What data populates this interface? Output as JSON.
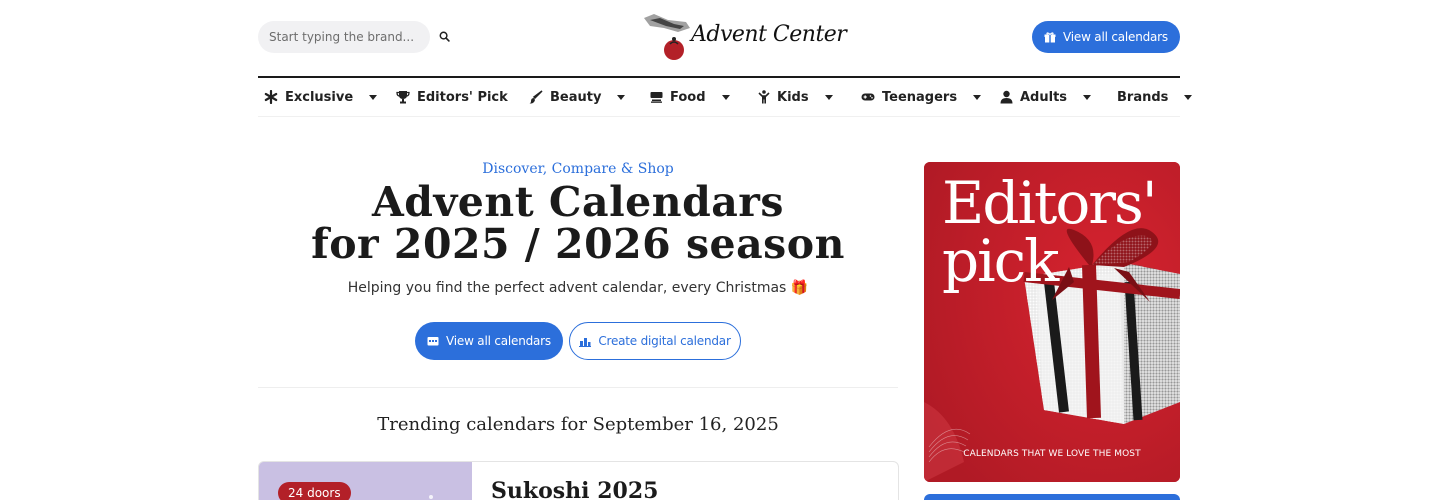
{
  "header": {
    "search_placeholder": "Start typing the brand...",
    "logo_text": "Advent Center",
    "view_all_label": "View all calendars"
  },
  "nav": {
    "items": [
      {
        "label": "Exclusive",
        "icon": "asterisk-icon",
        "dropdown": true
      },
      {
        "label": "Editors' Pick",
        "icon": "trophy-icon",
        "dropdown": false
      },
      {
        "label": "Beauty",
        "icon": "brush-icon",
        "dropdown": true
      },
      {
        "label": "Food",
        "icon": "food-icon",
        "dropdown": true
      },
      {
        "label": "Kids",
        "icon": "child-icon",
        "dropdown": true
      },
      {
        "label": "Teenagers",
        "icon": "gamepad-icon",
        "dropdown": true
      },
      {
        "label": "Adults",
        "icon": "user-icon",
        "dropdown": true
      },
      {
        "label": "Brands",
        "icon": "",
        "dropdown": true
      }
    ]
  },
  "hero": {
    "eyebrow": "Discover, Compare & Shop",
    "title_line1": "Advent Calendars",
    "title_line2": "for 2025 / 2026 season",
    "subtitle": "Helping you find the perfect advent calendar, every Christmas 🎁",
    "primary_button": "View all calendars",
    "secondary_button": "Create digital calendar"
  },
  "trending": {
    "heading": "Trending calendars for September 16, 2025"
  },
  "card": {
    "badge": "24 doors",
    "title": "Sukoshi 2025"
  },
  "banner": {
    "headline_line1": "Editors'",
    "headline_line2": "pick",
    "footer": "CALENDARS THAT WE LOVE THE MOST"
  },
  "colors": {
    "accent": "#2c6fdb",
    "banner_red": "#c51f2b",
    "badge_red": "#b32028"
  }
}
